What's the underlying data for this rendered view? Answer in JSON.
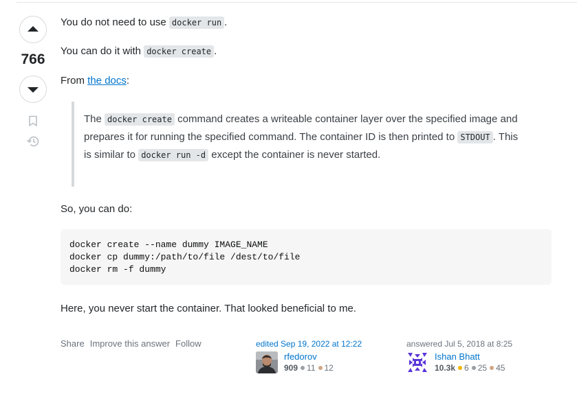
{
  "vote": {
    "count": "766"
  },
  "post": {
    "p1": {
      "text_before": "You do not need to use ",
      "code": "docker run",
      "text_after": "."
    },
    "p2": {
      "text_before": "You can do it with ",
      "code": "docker create",
      "text_after": "."
    },
    "p3": {
      "text_before": "From ",
      "link": "the docs",
      "text_after": ":"
    },
    "quote": {
      "t1": "The ",
      "c1": "docker create",
      "t2": " command creates a writeable container layer over the specified image and prepares it for running the specified command. The container ID is then printed to ",
      "c2": "STDOUT",
      "t3": ". This is similar to ",
      "c3": "docker run -d",
      "t4": " except the container is never started."
    },
    "p4": "So, you can do:",
    "code_lines": [
      "docker create --name dummy IMAGE_NAME",
      "docker cp dummy:/path/to/file /dest/to/file",
      "docker rm -f dummy"
    ],
    "p5": "Here, you never start the container. That looked beneficial to me."
  },
  "menu": {
    "share": "Share",
    "improve": "Improve this answer",
    "follow": "Follow"
  },
  "editor": {
    "action": "edited Sep 19, 2022 at 12:22",
    "name": "rfedorov",
    "reputation": "909",
    "silver": "11",
    "bronze": "12"
  },
  "author": {
    "action": "answered Jul 5, 2018 at 8:25",
    "name": "Ishan Bhatt",
    "reputation": "10.3k",
    "gold": "6",
    "silver": "25",
    "bronze": "45"
  },
  "colors": {
    "link": "#0074cc",
    "gold": "#f1b600",
    "silver": "#9a9fa4",
    "bronze": "#d1a684"
  },
  "icons": [
    "upvote-icon",
    "downvote-icon",
    "bookmark-icon",
    "history-icon"
  ]
}
